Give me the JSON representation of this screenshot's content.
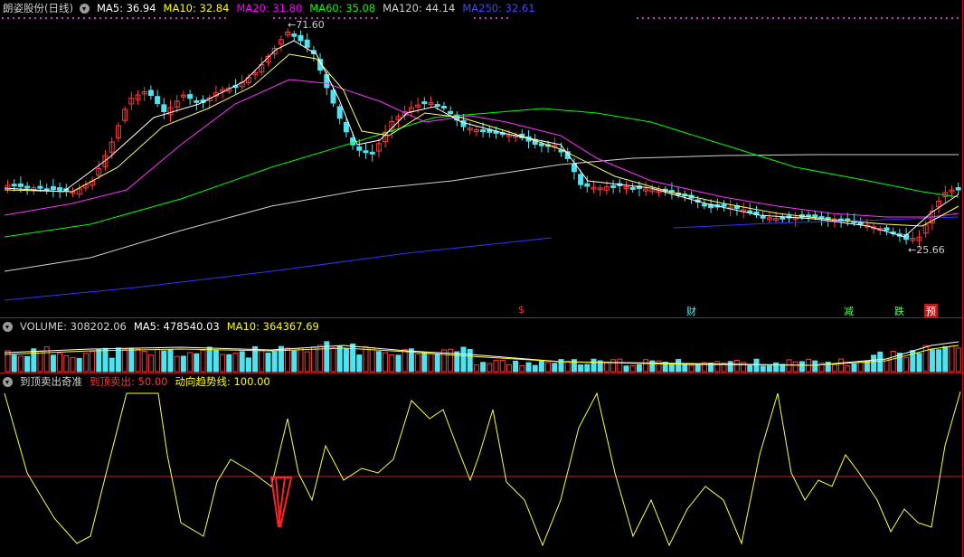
{
  "main": {
    "stock_name": "朗姿股份(日线)",
    "ma5": "MA5: 36.94",
    "ma10": "MA10: 32.84",
    "ma20": "MA20: 31.80",
    "ma60": "MA60: 35.08",
    "ma120": "MA120: 44.14",
    "ma250": "MA250: 32.61",
    "high_label": "71.60",
    "low_label": "25.66",
    "markers": [
      "$",
      "财",
      "减",
      "跌",
      "预"
    ],
    "colors": {
      "ma5": "#ffffff",
      "ma10": "#ffff00",
      "ma20": "#ff00ff",
      "ma60": "#00ff00",
      "ma120": "#d0d0d0",
      "ma250": "#3333ff"
    }
  },
  "volume": {
    "title": "VOLUME: 308202.06",
    "ma5": "MA5: 478540.03",
    "ma10": "MA10: 364367.69"
  },
  "indicator": {
    "title": "到顶卖出奇准",
    "sell": "到顶卖出: 50.00",
    "trend": "动向趋势线: 100.00"
  }
}
